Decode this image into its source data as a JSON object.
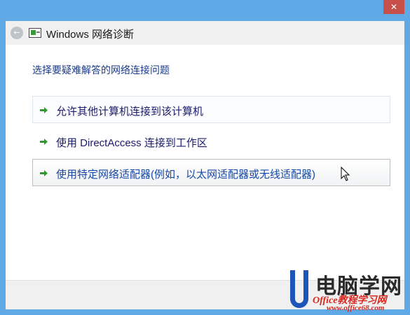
{
  "window": {
    "title": "Windows 网络诊断",
    "close_glyph": "✕",
    "back_glyph": "←"
  },
  "prompt": "选择要疑难解答的网络连接问题",
  "options": [
    {
      "label": "允许其他计算机连接到该计算机",
      "state": "hover"
    },
    {
      "label": "使用 DirectAccess 连接到工作区",
      "state": "normal"
    },
    {
      "label": "使用特定网络适配器(例如，以太网适配器或无线适配器)",
      "state": "selected"
    }
  ],
  "icons": {
    "back": "back-arrow-icon",
    "app": "network-diagnostics-icon",
    "option": "green-arrow-icon",
    "cursor": "mouse-pointer-icon"
  },
  "colors": {
    "frame": "#5fa9e6",
    "prompt_text": "#1a3a8a",
    "option_text": "#1b1b6e",
    "arrow_green": "#2c9a2c",
    "close_red": "#c7504a"
  },
  "watermark": {
    "brand": "电脑学网",
    "sub": "Office教程学习网",
    "url": "www.office68.com"
  }
}
